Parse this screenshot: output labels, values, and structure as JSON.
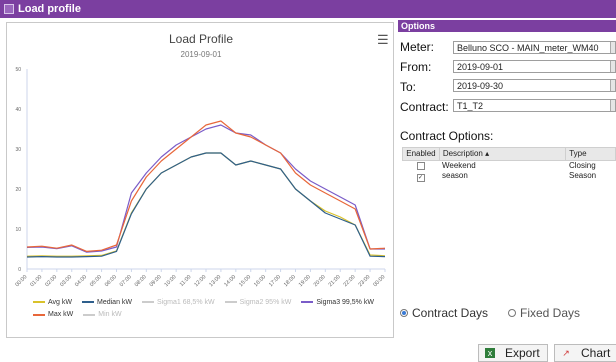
{
  "window": {
    "title": "Load profile"
  },
  "chart_panel": {
    "title": "Load Profile",
    "subtitle": "2019-09-01",
    "menu_icon": "hamburger-menu-icon"
  },
  "chart_data": {
    "type": "line",
    "title": "Load Profile",
    "subtitle": "2019-09-01",
    "xlabel": "",
    "ylabel": "",
    "ylim": [
      0,
      50
    ],
    "yticks": [
      0,
      10,
      20,
      30,
      40,
      50
    ],
    "categories": [
      "00:00",
      "01:00",
      "02:00",
      "03:00",
      "04:00",
      "05:00",
      "06:00",
      "07:00",
      "08:00",
      "09:00",
      "10:00",
      "11:00",
      "12:00",
      "13:00",
      "14:00",
      "15:00",
      "16:00",
      "17:00",
      "18:00",
      "19:00",
      "20:00",
      "21:00",
      "22:00",
      "23:00",
      "00:00"
    ],
    "grid": false,
    "legend_position": "bottom",
    "series": [
      {
        "name": "Avg kW",
        "color": "#d9c22b",
        "visible": true,
        "values": [
          3.2,
          3.3,
          3.2,
          3.2,
          3.3,
          3.4,
          4.5,
          14,
          20,
          24,
          26,
          28,
          29,
          29,
          26,
          27,
          26,
          25,
          20,
          17,
          14.5,
          13,
          11,
          3.5,
          3.3
        ]
      },
      {
        "name": "Median kW",
        "color": "#2e5f8c",
        "visible": true,
        "values": [
          3,
          3.1,
          3,
          3,
          3.1,
          3.2,
          4.4,
          13.8,
          20,
          24,
          26,
          28,
          29,
          29,
          26,
          27,
          26,
          25,
          20,
          17,
          14,
          12.5,
          11,
          3.2,
          3.1
        ]
      },
      {
        "name": "Sigma1 68,5% kW",
        "color": "#cccccc",
        "visible": false,
        "values": []
      },
      {
        "name": "Sigma2 95% kW",
        "color": "#cccccc",
        "visible": false,
        "values": []
      },
      {
        "name": "Sigma3 99,5% kW",
        "color": "#7a5cc8",
        "visible": true,
        "values": [
          5.4,
          5.5,
          5.1,
          5.8,
          4.2,
          4.5,
          5.5,
          19,
          24,
          28,
          31,
          33,
          35,
          36,
          34,
          33.5,
          31,
          29,
          25,
          22,
          20,
          18,
          16,
          5,
          5
        ]
      },
      {
        "name": "Max kW",
        "color": "#e8673a",
        "visible": true,
        "values": [
          5.5,
          5.7,
          5.2,
          6,
          4.4,
          4.7,
          6,
          17,
          23,
          27,
          30,
          33,
          36,
          37,
          34,
          33,
          31,
          29,
          24,
          21,
          19,
          17,
          15,
          5,
          5.2
        ]
      },
      {
        "name": "Min kW",
        "color": "#cccccc",
        "visible": false,
        "values": []
      }
    ]
  },
  "options": {
    "header": "Options",
    "meter_label": "Meter:",
    "meter_value": "Belluno SCO - MAIN_meter_WM40",
    "from_label": "From:",
    "from_value": "2019-09-01",
    "to_label": "To:",
    "to_value": "2019-09-30",
    "contract_label": "Contract:",
    "contract_value": "T1_T2",
    "contract_options_label": "Contract Options:",
    "table": {
      "headers": [
        "Enabled",
        "Description ▴",
        "Type"
      ],
      "rows": [
        {
          "enabled": false,
          "description": "Weekend",
          "type": "Closing"
        },
        {
          "enabled": true,
          "description": "season",
          "type": "Season"
        }
      ]
    },
    "radio_contract_days": "Contract Days",
    "radio_fixed_days": "Fixed Days",
    "radio_selected": "contract_days",
    "export_label": "Export",
    "chart_label": "Chart"
  }
}
